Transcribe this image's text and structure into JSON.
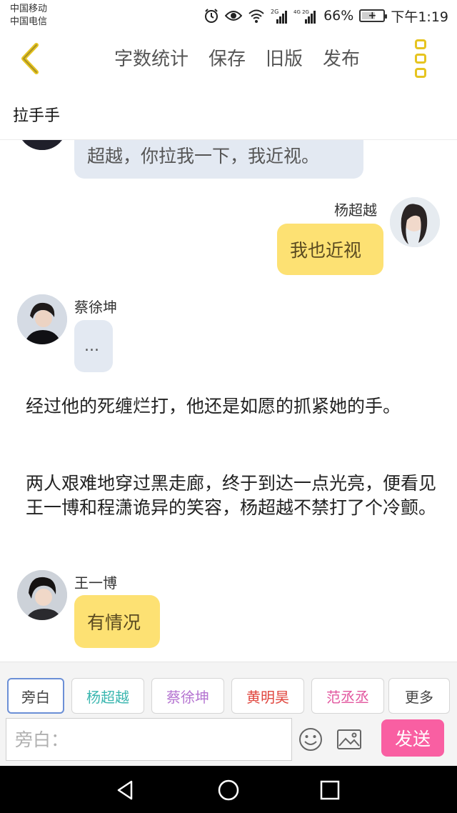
{
  "status": {
    "carrier1": "中国移动",
    "carrier2": "中国电信",
    "net1": "2G",
    "net2": "4G 2G",
    "battery_text": "66%",
    "battery_level": 0.66,
    "time": "下午1:19"
  },
  "toolbar": {
    "word_count": "字数统计",
    "save": "保存",
    "old_version": "旧版",
    "publish": "发布"
  },
  "story": {
    "title": "拉手手"
  },
  "messages": [
    {
      "speaker": "",
      "text": "超越，你拉我一下，我近视。",
      "side": "left",
      "color": "grey"
    },
    {
      "speaker": "杨超越",
      "text": "我也近视",
      "side": "right",
      "color": "yellow"
    },
    {
      "speaker": "蔡徐坤",
      "text": "...",
      "side": "left",
      "color": "grey"
    },
    {
      "narration": "经过他的死缠烂打，他还是如愿的抓紧她的手。"
    },
    {
      "narration": "两人艰难地穿过黑走廊，终于到达一点光亮，便看见王一博和程潇诡异的笑容，杨超越不禁打了个冷颤。"
    },
    {
      "speaker": "王一博",
      "text": "有情况",
      "side": "left",
      "color": "yellow"
    }
  ],
  "roles": [
    {
      "label": "旁白",
      "color": "#444444"
    },
    {
      "label": "杨超越",
      "color": "#3cb7b0"
    },
    {
      "label": "蔡徐坤",
      "color": "#b575d1"
    },
    {
      "label": "黄明昊",
      "color": "#e0473f"
    },
    {
      "label": "范丞丞",
      "color": "#e2579f"
    },
    {
      "label": "更多",
      "color": "#444444"
    }
  ],
  "input": {
    "placeholder": "旁白："
  },
  "send": {
    "label": "发送"
  },
  "colors": {
    "accent": "#e6c420",
    "send": "#f95fa2",
    "bubble_yellow": "#fde173",
    "bubble_grey": "#e3e9f2"
  }
}
